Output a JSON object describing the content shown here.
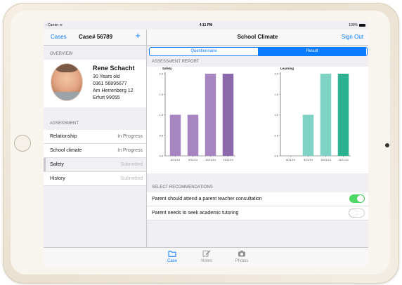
{
  "status_bar": {
    "carrier": "Carrier",
    "time": "4:11 PM",
    "battery": "100%"
  },
  "left_nav": {
    "back_label": "Cases",
    "title": "Case# 56789",
    "add_label": "+"
  },
  "overview": {
    "header": "OVERVIEW",
    "name": "Rene Schacht",
    "lines": [
      "30 Years old",
      "0361 56895677",
      "Am Herrenberg 12",
      "Erfurt 99055"
    ]
  },
  "assessment": {
    "header": "ASSESSMENT",
    "items": [
      {
        "label": "Relationship",
        "status": "In Progress"
      },
      {
        "label": "School climate",
        "status": "In Progress"
      },
      {
        "label": "Safety",
        "status": "Submitted"
      },
      {
        "label": "History",
        "status": "Submitted"
      }
    ]
  },
  "right_nav": {
    "title": "School Climate",
    "signout_label": "Sign Out"
  },
  "segments": {
    "questionnaire": "Questionnaire",
    "result": "Result"
  },
  "report_header": "ASSESSMENT REPORT",
  "chart_data": [
    {
      "type": "bar",
      "title": "Safety",
      "categories": [
        "8/21/14",
        "9/21/14",
        "10/21/14",
        "11/21/14"
      ],
      "values": [
        1.0,
        1.0,
        2.0,
        2.0
      ],
      "ylim": [
        0,
        2.0
      ],
      "yticks": [
        "0.0",
        "0.5",
        "1.0",
        "1.5",
        "2.0"
      ],
      "colors": [
        "#a785c1",
        "#a785c1",
        "#a785c1",
        "#8b69aa"
      ]
    },
    {
      "type": "bar",
      "title": "Learning",
      "categories": [
        "8/21/14",
        "9/21/14",
        "10/21/14",
        "11/21/14"
      ],
      "values": [
        0,
        1.0,
        2.0,
        2.0
      ],
      "ylim": [
        0,
        2.0
      ],
      "yticks": [
        "0.0",
        "0.5",
        "1.0",
        "1.5",
        "2.0"
      ],
      "colors": [
        "#7fd3c4",
        "#7fd3c4",
        "#7fd3c4",
        "#2bb391"
      ]
    }
  ],
  "recommendations": {
    "header": "SELECT RECOMMENDATIONS",
    "items": [
      {
        "label": "Parent should attend a parent teacher consultation",
        "on": true
      },
      {
        "label": "Parent needs to seek academic tutoring",
        "on": false
      }
    ]
  },
  "tabs": [
    {
      "label": "Case",
      "icon": "folder-icon",
      "active": true
    },
    {
      "label": "Notes",
      "icon": "pencil-icon",
      "active": false
    },
    {
      "label": "Photos",
      "icon": "camera-icon",
      "active": false
    }
  ],
  "colors": {
    "accent": "#0a7cff",
    "toggle_on": "#4cd964"
  }
}
